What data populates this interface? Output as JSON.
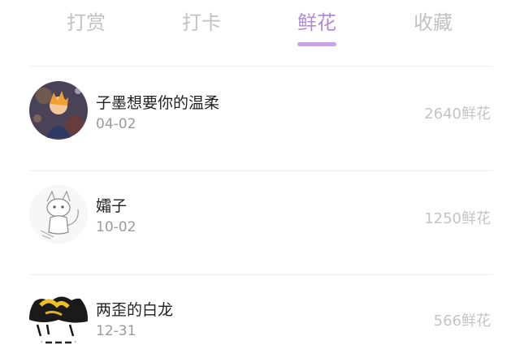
{
  "tabs": [
    {
      "label": "打赏"
    },
    {
      "label": "打卡"
    },
    {
      "label": "鲜花"
    },
    {
      "label": "收藏"
    }
  ],
  "active_tab": "鲜花",
  "records": [
    {
      "name": "子墨想要你的温柔",
      "date": "04-02",
      "amount": "2640鲜花",
      "avatar_icon": "anime-character-avatar"
    },
    {
      "name": "孀子",
      "date": "10-02",
      "amount": "1250鲜花",
      "avatar_icon": "sketch-fox-avatar"
    },
    {
      "name": "两歪的白龙",
      "date": "12-31",
      "amount": "566鲜花",
      "avatar_icon": "ink-painting-avatar"
    }
  ],
  "colors": {
    "accent": "#b28bd6",
    "tab_inactive": "#c2c2c2",
    "amount_text": "#c4c4c4",
    "date_text": "#9a9a9a"
  }
}
